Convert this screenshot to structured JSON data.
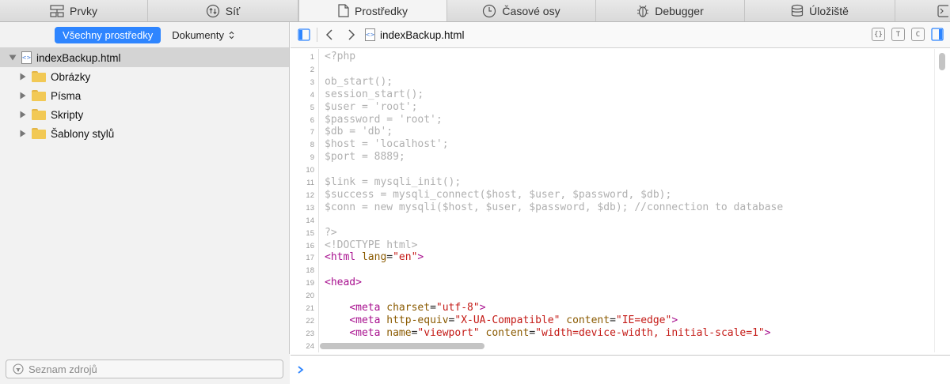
{
  "tabs": [
    {
      "label": "Prvky",
      "icon": "elements-icon"
    },
    {
      "label": "Síť",
      "icon": "network-icon"
    },
    {
      "label": "Prostředky",
      "icon": "resources-icon",
      "selected": true
    },
    {
      "label": "Časové osy",
      "icon": "timelines-icon"
    },
    {
      "label": "Debugger",
      "icon": "debugger-icon"
    },
    {
      "label": "Úložiště",
      "icon": "storage-icon"
    }
  ],
  "sidebar": {
    "scope_active": "Všechny prostředky",
    "scope_select": "Dokumenty",
    "tree": {
      "root": "indexBackup.html",
      "folders": [
        "Obrázky",
        "Písma",
        "Skripty",
        "Šablony stylů"
      ]
    },
    "filter_placeholder": "Seznam zdrojů"
  },
  "editor": {
    "file_name": "indexBackup.html",
    "right_buttons": [
      "{}",
      "T",
      "C"
    ],
    "accent": "#2e85ff",
    "lines": [
      {
        "n": "1",
        "text": "<?php"
      },
      {
        "n": "2",
        "text": ""
      },
      {
        "n": "3",
        "text": "ob_start();"
      },
      {
        "n": "4",
        "text": "session_start();"
      },
      {
        "n": "5",
        "text": "$user = 'root';"
      },
      {
        "n": "6",
        "text": "$password = 'root';"
      },
      {
        "n": "7",
        "text": "$db = 'db';"
      },
      {
        "n": "8",
        "text": "$host = 'localhost';"
      },
      {
        "n": "9",
        "text": "$port = 8889;"
      },
      {
        "n": "10",
        "text": ""
      },
      {
        "n": "11",
        "text": "$link = mysqli_init();"
      },
      {
        "n": "12",
        "text": "$success = mysqli_connect($host, $user, $password, $db);"
      },
      {
        "n": "13",
        "text": "$conn = new mysqli($host, $user, $password, $db); //connection to database"
      },
      {
        "n": "14",
        "text": ""
      },
      {
        "n": "15",
        "text": "?>"
      },
      {
        "n": "16",
        "text": "<!DOCTYPE html>"
      },
      {
        "n": "17",
        "tag": "html",
        "attrs": [
          {
            "name": "lang",
            "value": "\"en\""
          }
        ]
      },
      {
        "n": "18",
        "text": ""
      },
      {
        "n": "19",
        "tag": "head",
        "attrs": []
      },
      {
        "n": "20",
        "text": ""
      },
      {
        "n": "21",
        "indent": "    ",
        "tag": "meta",
        "attrs": [
          {
            "name": "charset",
            "value": "\"utf-8\""
          }
        ]
      },
      {
        "n": "22",
        "indent": "    ",
        "tag": "meta",
        "attrs": [
          {
            "name": "http-equiv",
            "value": "\"X-UA-Compatible\""
          },
          {
            "name": "content",
            "value": "\"IE=edge\""
          }
        ]
      },
      {
        "n": "23",
        "indent": "    ",
        "tag": "meta",
        "attrs": [
          {
            "name": "name",
            "value": "\"viewport\""
          },
          {
            "name": "content",
            "value": "\"width=device-width, initial-scale=1\""
          }
        ]
      },
      {
        "n": "24",
        "text": ""
      }
    ]
  }
}
